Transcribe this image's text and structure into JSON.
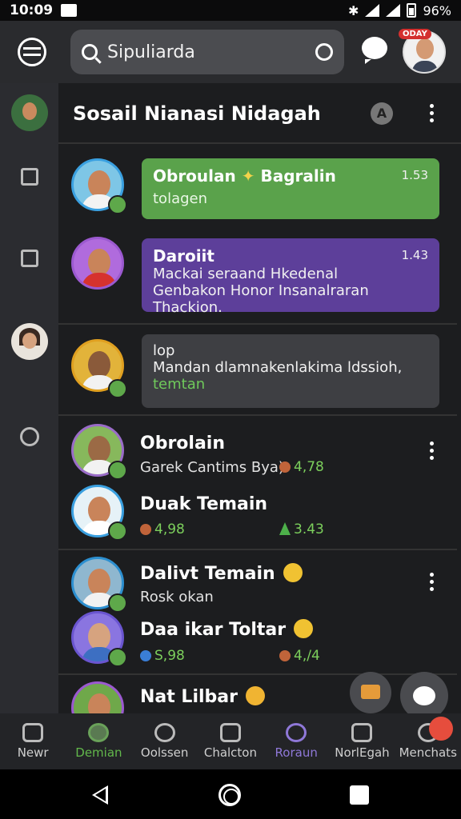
{
  "status": {
    "time": "10:09",
    "battery": "96%"
  },
  "search": {
    "value": "Sipuliarda"
  },
  "profile_badge": "ODAY",
  "header": {
    "title": "Sosail Nianasi Nidagah",
    "a_icon": "A"
  },
  "messages": [
    {
      "title": "Obroulan",
      "title_suffix": "Bagralin",
      "time": "1.53",
      "text": "tolagen"
    },
    {
      "title": "Daroiit",
      "time": "1.43",
      "text1": "Mackai seraand Hkedenal",
      "text2": "Genbakon Honor Insanalraran Thackion."
    },
    {
      "title": "lop",
      "text": "Mandan dlamnakenlakima ldssioh,",
      "green_text": "temtan"
    }
  ],
  "groups": [
    {
      "users": [
        {
          "name": "Obrolain",
          "sub": "Garek Cantims Bya)",
          "stat_a": "4,78"
        },
        {
          "name": "Duak Temain",
          "stat_a": "4,98",
          "stat_b": "3.43"
        }
      ]
    },
    {
      "users": [
        {
          "name": "Dalivt Temain",
          "sub": "Rosk okan"
        },
        {
          "name": "Daa ikar Toltar",
          "stat_a": "S,98",
          "stat_b": "4,/4"
        }
      ]
    },
    {
      "users": [
        {
          "name": "Nat Lilbar"
        }
      ]
    }
  ],
  "tabs": [
    "Newr",
    "Demian",
    "Oolssen",
    "Chalcton",
    "Roraun",
    "NorlEgah",
    "Menchats"
  ],
  "icons": {
    "menu": "menu-icon",
    "search": "search-icon",
    "scan": "scan-icon",
    "chat": "chat-icon",
    "mail": "mail-icon",
    "compose": "compose-icon"
  },
  "colors": {
    "green": "#5aa24b",
    "purple": "#5d3f9a",
    "accent_green": "#62b84b"
  }
}
